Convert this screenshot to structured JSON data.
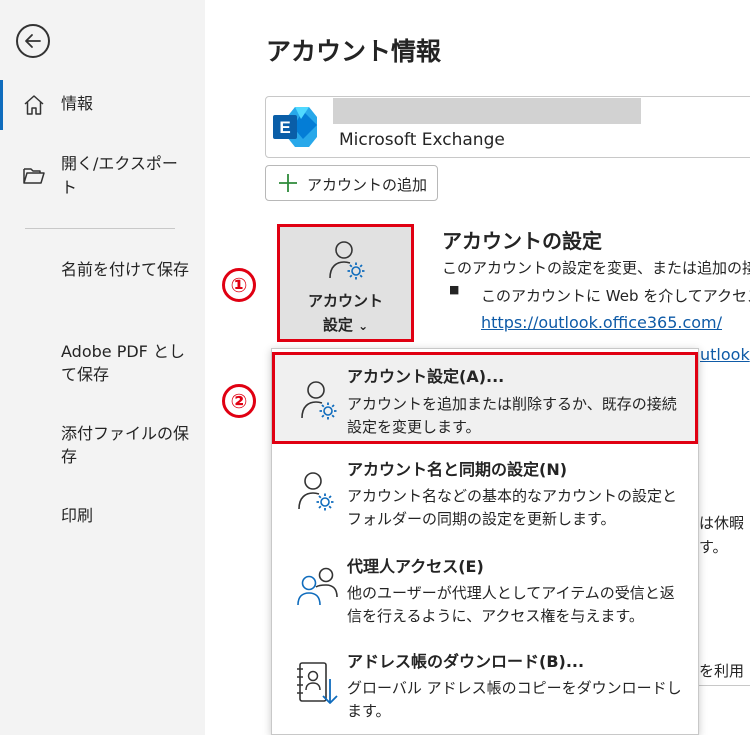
{
  "sidebar": {
    "items": [
      {
        "label": "情報",
        "icon": "home-icon",
        "active": true
      },
      {
        "label": "開く/エクスポート",
        "icon": "folder-open-icon"
      }
    ],
    "sub_items": [
      "名前を付けて保存",
      "Adobe PDF として保存",
      "添付ファイルの保存",
      "印刷"
    ]
  },
  "main": {
    "title": "アカウント情報",
    "account": {
      "type": "Microsoft Exchange",
      "logo": "exchange-logo"
    },
    "add_account_label": "アカウントの追加",
    "settings_tile": {
      "line1": "アカウント",
      "line2": "設定",
      "chevron": "⌄"
    },
    "section_title": "アカウントの設定",
    "section_desc": "このアカウントの設定を変更、または追加の接",
    "bullet_text": "このアカウントに Web を介してアクセス",
    "link1": "https://outlook.office365.com/",
    "link2_peek": "utlook",
    "peek_right": [
      "は休暇",
      "す。",
      "を利用"
    ]
  },
  "callouts": {
    "step1": "①",
    "step2": "②"
  },
  "menu": {
    "items": [
      {
        "title": "アカウント設定(A)...",
        "desc": "アカウントを追加または削除するか、既存の接続設定を変更します。",
        "icon": "person-gear-icon",
        "highlighted": true
      },
      {
        "title": "アカウント名と同期の設定(N)",
        "desc": "アカウント名などの基本的なアカウントの設定とフォルダーの同期の設定を更新します。",
        "icon": "person-gear-icon"
      },
      {
        "title": "代理人アクセス(E)",
        "desc": "他のユーザーが代理人としてアイテムの受信と返信を行えるように、アクセス権を与えます。",
        "icon": "delegate-people-icon"
      },
      {
        "title": "アドレス帳のダウンロード(B)...",
        "desc": "グローバル アドレス帳のコピーをダウンロードします。",
        "icon": "address-book-download-icon"
      }
    ]
  },
  "colors": {
    "accent": "#0f6cbd",
    "callout_red": "#e00012",
    "exchange_blue": "#0a7ad6"
  }
}
